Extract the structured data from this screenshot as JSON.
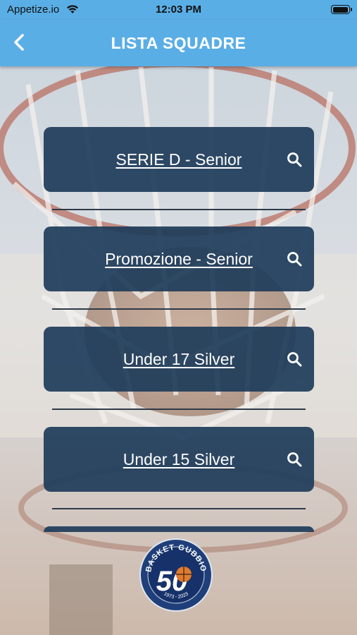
{
  "status_bar": {
    "carrier": "Appetize.io",
    "time": "12:03 PM",
    "wifi_icon": "wifi-icon",
    "battery_icon": "battery-icon",
    "battery_level": 1.0
  },
  "nav": {
    "title": "LISTA SQUADRE",
    "back_icon": "chevron-left-icon"
  },
  "colors": {
    "nav_background": "#5aaee6",
    "card_background": "#1e3c5a",
    "text": "#ffffff"
  },
  "teams": [
    {
      "label": "SERIE D - Senior",
      "icon": "search-icon"
    },
    {
      "label": "Promozione - Senior",
      "icon": "search-icon"
    },
    {
      "label": "Under 17 Silver",
      "icon": "search-icon"
    },
    {
      "label": "Under 15 Silver",
      "icon": "search-icon"
    }
  ],
  "logo": {
    "name": "basket-gubbio-logo",
    "text_top": "BASKET GUBBIO",
    "number": "50",
    "years": "1973 - 2023"
  }
}
